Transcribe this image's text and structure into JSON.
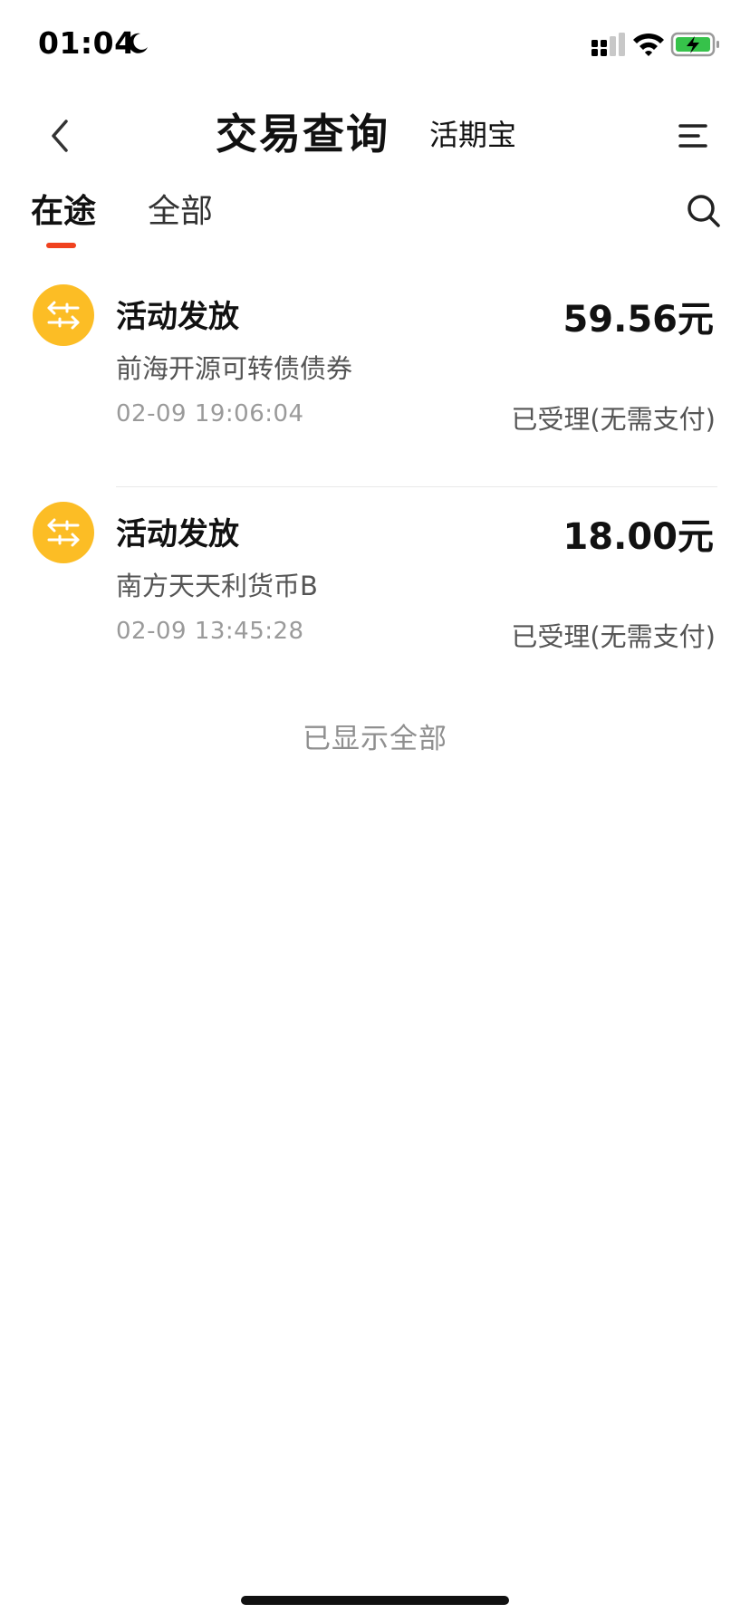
{
  "status_bar": {
    "time": "01:04",
    "icons": [
      "moon-icon",
      "signal-icon",
      "wifi-icon",
      "battery-charging-icon"
    ]
  },
  "nav": {
    "back_icon": "chevron-left-icon",
    "title": "交易查询",
    "product_tab": "活期宝",
    "menu_icon": "menu-icon"
  },
  "tabs": {
    "items": [
      {
        "label": "在途",
        "active": true
      },
      {
        "label": "全部",
        "active": false
      }
    ],
    "search_icon": "search-icon"
  },
  "transactions": [
    {
      "title": "活动发放",
      "amount": "59.56元",
      "fund": "前海开源可转债债券",
      "time": "02-09 19:06:04",
      "status": "已受理(无需支付)",
      "icon": "transfer-arrows-icon"
    },
    {
      "title": "活动发放",
      "amount": "18.00元",
      "fund": "南方天天利货币B",
      "time": "02-09 13:45:28",
      "status": "已受理(无需支付)",
      "icon": "transfer-arrows-icon"
    }
  ],
  "list_end_text": "已显示全部",
  "colors": {
    "accent": "#f0421f",
    "icon_bg": "#fcbd25",
    "battery_green": "#36c24a"
  }
}
